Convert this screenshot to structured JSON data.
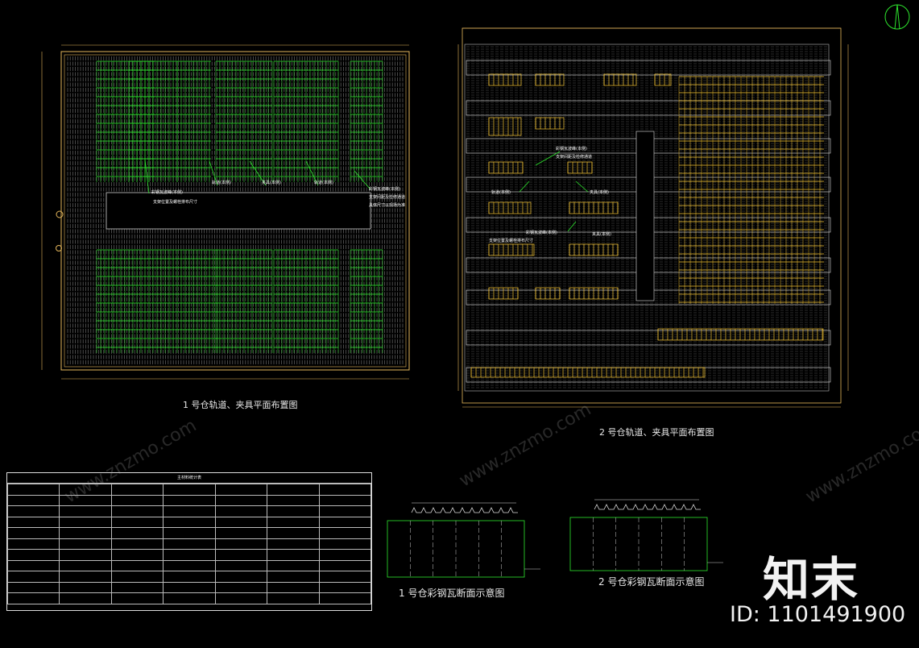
{
  "plan1": {
    "title": "1 号仓轨道、夹具平面布置图",
    "callouts": [
      "彩钢瓦波峰(本侧)",
      "支架位置及螺栓排布尺寸",
      "轨道(本侧)",
      "夹具(本侧)",
      "轨道(本侧)",
      "彩钢瓦波峰(本侧)",
      "支架间距及检修通道",
      "具体尺寸以现场为准"
    ]
  },
  "plan2": {
    "title": "2 号仓轨道、夹具平面布置图",
    "callouts": [
      "彩钢瓦波峰(本侧)",
      "支架间距及检修通道",
      "轨道(本侧)",
      "夹具(本侧)",
      "彩钢瓦波峰(本侧)",
      "夹具(本侧)",
      "支架位置及螺栓排布尺寸"
    ]
  },
  "section1": {
    "title": "1 号仓彩钢瓦断面示意图"
  },
  "section2": {
    "title": "2 号仓彩钢瓦断面示意图"
  },
  "table": {
    "title": "主材料统计表"
  },
  "watermark": {
    "logo": "知末",
    "id": "ID: 1101491900",
    "site": "www.znzmo.com"
  },
  "colors": {
    "background": "#000000",
    "frame": "#e6b85c",
    "green_clamp": "#2ee82e",
    "yellow_clamp": "#f2c232",
    "notes_text": "#3fd0ff",
    "red_text": "#ff3030"
  }
}
